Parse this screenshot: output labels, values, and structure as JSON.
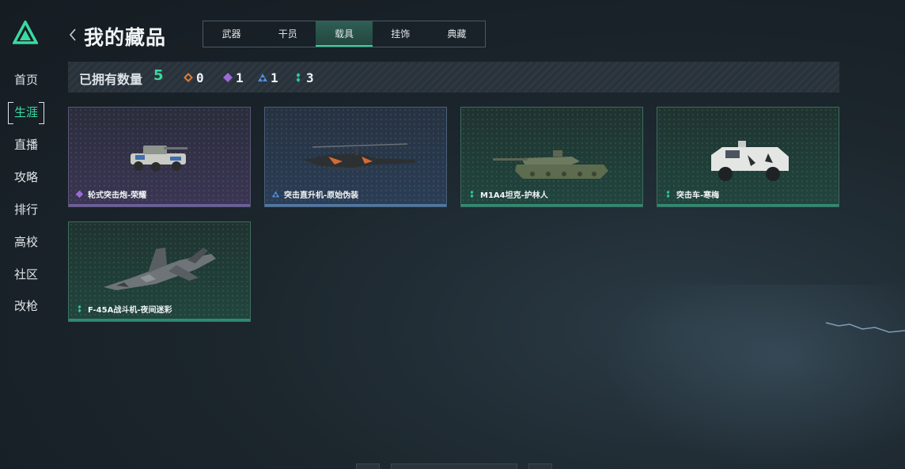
{
  "sidebar": {
    "items": [
      {
        "label": "首页"
      },
      {
        "label": "生涯"
      },
      {
        "label": "直播"
      },
      {
        "label": "攻略"
      },
      {
        "label": "排行"
      },
      {
        "label": "高校"
      },
      {
        "label": "社区"
      },
      {
        "label": "改枪"
      }
    ],
    "active_index": 1
  },
  "header": {
    "title": "我的藏品",
    "tabs": [
      {
        "label": "武器"
      },
      {
        "label": "干员"
      },
      {
        "label": "载具"
      },
      {
        "label": "挂饰"
      },
      {
        "label": "典藏"
      }
    ],
    "active_tab": 2
  },
  "summary": {
    "label": "已拥有数量",
    "count": "5",
    "rarities": [
      {
        "icon": "orange-diamond-icon",
        "color": "#d9783a",
        "value": "0"
      },
      {
        "icon": "purple-diamond-icon",
        "color": "#9a6ad8",
        "value": "1"
      },
      {
        "icon": "blue-triangle-icon",
        "color": "#4f8fd8",
        "value": "1"
      },
      {
        "icon": "green-dots-icon",
        "color": "#32c79a",
        "value": "3"
      }
    ]
  },
  "items": [
    {
      "name": "轮式突击炮-荣耀",
      "rarity": "purple"
    },
    {
      "name": "突击直升机-原始伪装",
      "rarity": "blue"
    },
    {
      "name": "M1A4坦克-护林人",
      "rarity": "green"
    },
    {
      "name": "突击车-寒梅",
      "rarity": "green"
    },
    {
      "name": "F-45A战斗机-夜间迷彩",
      "rarity": "green"
    }
  ],
  "colors": {
    "accent": "#3ad9a0",
    "purple": "#9a6ad8",
    "blue": "#4f8fd8",
    "green": "#32c79a"
  }
}
